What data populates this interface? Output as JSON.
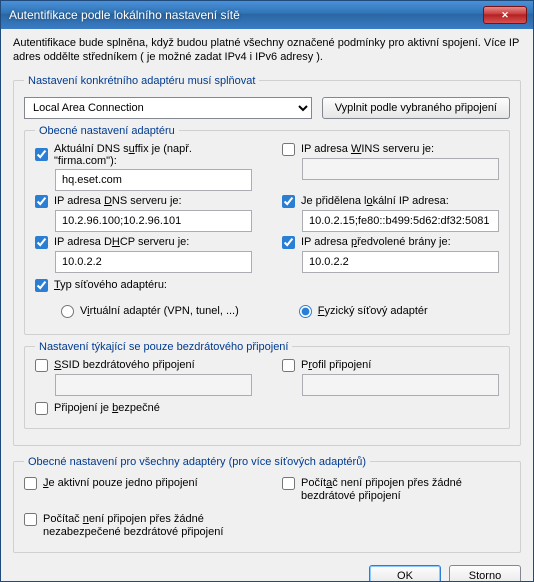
{
  "title": "Autentifikace podle lokálního nastavení sítě",
  "intro": "Autentifikace bude splněna, když budou platné všechny označené podmínky pro aktivní spojení. Více IP adres oddělte středníkem ( je možné zadat IPv4 i IPv6 adresy ).",
  "adapter_frame_legend": "Nastavení konkrétního adaptéru musí splňovat",
  "adapter_combo_value": "Local Area Connection",
  "fill_button": "Vyplnit podle vybraného připojení",
  "general_legend": "Obecné nastavení adaptéru",
  "general": {
    "dns_suffix": {
      "pre": "Aktuální DNS s",
      "u": "u",
      "post": "ffix je (např. \"firma.com\"):",
      "val": "hq.eset.com",
      "checked": true
    },
    "wins": {
      "pre": "IP adresa ",
      "u": "W",
      "post": "INS serveru je:",
      "val": "",
      "checked": false
    },
    "dns_ip": {
      "pre": "IP adresa ",
      "u": "D",
      "post": "NS serveru je:",
      "val": "10.2.96.100;10.2.96.101",
      "checked": true
    },
    "local_ip": {
      "pre": "Je přidělena l",
      "u": "o",
      "post": "kální IP adresa:",
      "val": "10.0.2.15;fe80::b499:5d62:df32:5081",
      "checked": true
    },
    "dhcp": {
      "pre": "IP adresa D",
      "u": "H",
      "post": "CP serveru je:",
      "val": "10.0.2.2",
      "checked": true
    },
    "gateway": {
      "pre": "IP adresa ",
      "u": "p",
      "post": "ředvolené brány je:",
      "val": "10.0.2.2",
      "checked": true
    },
    "net_type": {
      "pre": "",
      "u": "T",
      "post": "yp síťového adaptéru:",
      "checked": true
    },
    "radio_virtual": {
      "pre": "V",
      "u": "i",
      "post": "rtuální adaptér (VPN, tunel, ...)"
    },
    "radio_physical": {
      "pre": "",
      "u": "F",
      "post": "yzický síťový adaptér"
    }
  },
  "wireless_legend": "Nastavení týkající se pouze bezdrátového připojení",
  "wireless": {
    "ssid": {
      "pre": "",
      "u": "S",
      "post": "SID bezdrátového připojení",
      "val": ""
    },
    "profile": {
      "pre": "P",
      "u": "r",
      "post": "ofil připojení",
      "val": ""
    },
    "secure": {
      "pre": "Připojení je ",
      "u": "b",
      "post": "ezpečné"
    }
  },
  "all_adapters_legend": "Obecné nastavení pro všechny adaptéry (pro více síťových adaptérů)",
  "all": {
    "one_active": {
      "pre": "",
      "u": "J",
      "post": "e aktivní pouze jedno připojení"
    },
    "none_wireless": {
      "pre": "Počít",
      "u": "a",
      "post": "č není připojen přes žádné bezdrátové připojení"
    },
    "none_insecure_wl": {
      "pre": "Počítač ",
      "u": "n",
      "post": "ení připojen přes žádné nezabezpečené bezdrátové připojení"
    }
  },
  "ok": "OK",
  "cancel": "Storno"
}
